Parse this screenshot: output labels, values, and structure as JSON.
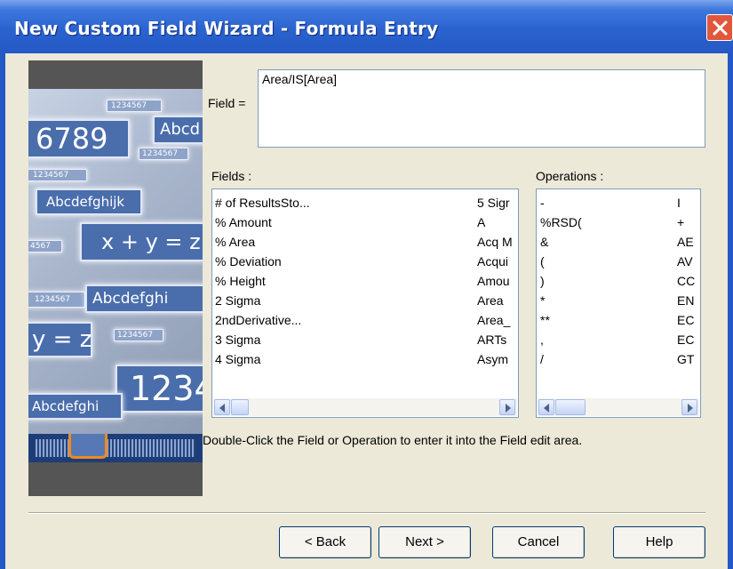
{
  "window": {
    "title": "New Custom Field Wizard - Formula Entry"
  },
  "banner": {
    "tiles": [
      "1234567",
      "6789",
      "Abcd",
      "1234567",
      "1234567",
      "Abcdefghijk",
      "x + y = z",
      "4567",
      "1234567",
      "Abcdefghi",
      "y = z",
      "1234567",
      "1234",
      "Abcdefghi"
    ]
  },
  "form": {
    "field_label": "Field =",
    "field_value": "Area/IS[Area]",
    "fields_label": "Fields :",
    "operations_label": "Operations :",
    "fields_col1": [
      "# of ResultsSto...",
      "% Amount",
      "% Area",
      "% Deviation",
      "% Height",
      "2 Sigma",
      "2ndDerivative...",
      "3 Sigma",
      "4 Sigma"
    ],
    "fields_col2": [
      "5 Sigr",
      "A",
      "Acq M",
      "Acqui",
      "Amou",
      "Area",
      "Area_",
      "ARTs",
      "Asym"
    ],
    "ops_col1": [
      "-",
      "%RSD(",
      "&",
      "(",
      ")",
      "*",
      "**",
      ",",
      "/"
    ],
    "ops_col2": [
      "I",
      "+",
      "AE",
      "AV",
      "CC",
      "EN",
      "EC",
      "EC",
      "GT"
    ],
    "hint": "Double-Click the Field or Operation to enter it into the Field edit area."
  },
  "buttons": {
    "back": "< Back",
    "next": "Next >",
    "cancel": "Cancel",
    "help": "Help"
  }
}
